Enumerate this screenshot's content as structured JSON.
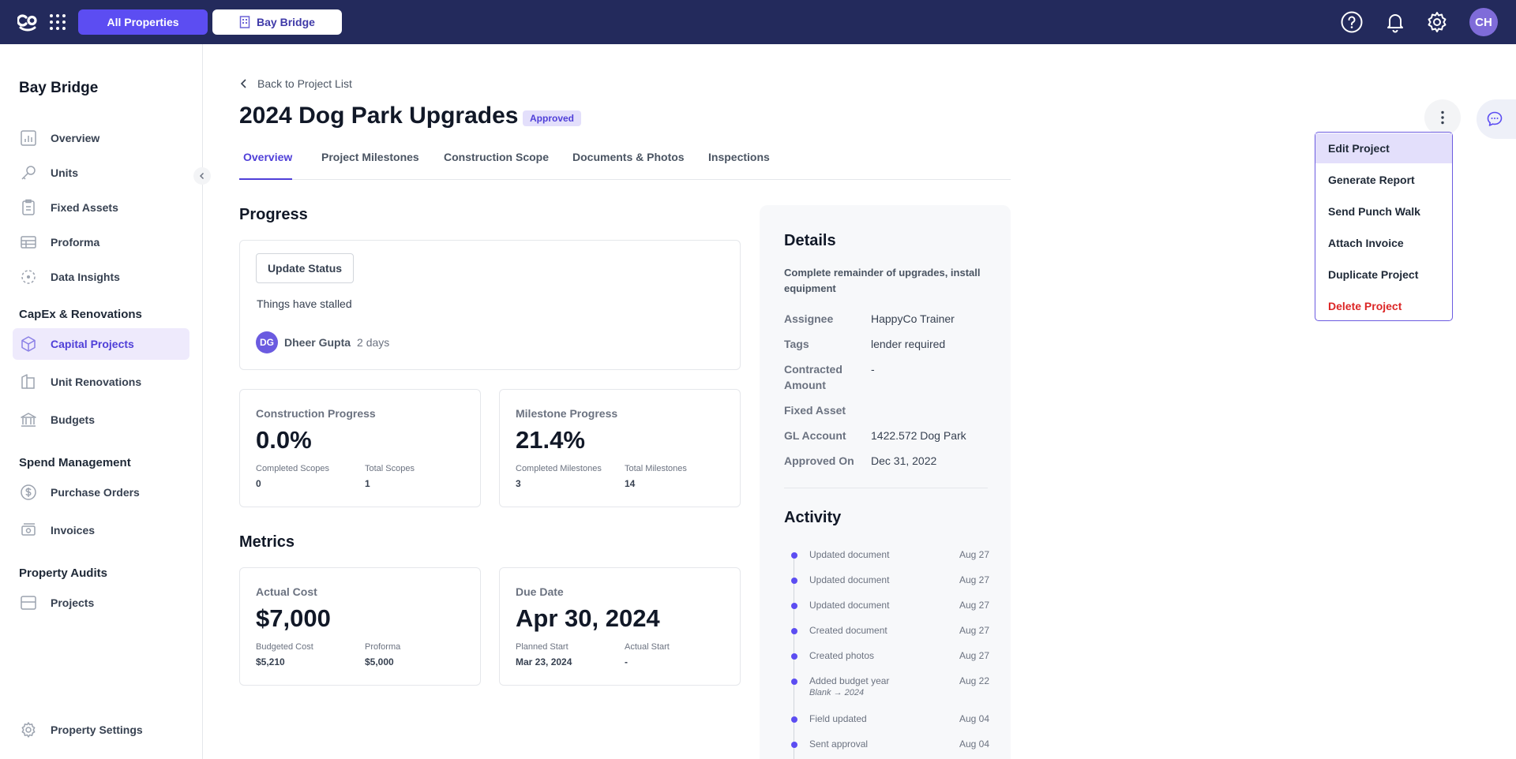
{
  "topbar": {
    "all_properties": "All Properties",
    "property": "Bay Bridge",
    "avatar_initials": "CH"
  },
  "sidebar": {
    "title": "Bay Bridge",
    "items": [
      {
        "label": "Overview",
        "icon": "chart-icon"
      },
      {
        "label": "Units",
        "icon": "key-icon"
      },
      {
        "label": "Fixed Assets",
        "icon": "clipboard-icon"
      },
      {
        "label": "Proforma",
        "icon": "table-icon"
      },
      {
        "label": "Data Insights",
        "icon": "insights-icon"
      }
    ],
    "section_capex": "CapEx & Renovations",
    "capex_items": [
      {
        "label": "Capital Projects",
        "icon": "box-icon",
        "active": true
      },
      {
        "label": "Unit Renovations",
        "icon": "paint-icon"
      },
      {
        "label": "Budgets",
        "icon": "bank-icon"
      }
    ],
    "section_spend": "Spend Management",
    "spend_items": [
      {
        "label": "Purchase Orders",
        "icon": "dollar-icon"
      },
      {
        "label": "Invoices",
        "icon": "invoice-icon"
      }
    ],
    "section_audits": "Property Audits",
    "audit_items": [
      {
        "label": "Projects",
        "icon": "projects-icon"
      }
    ],
    "settings_label": "Property Settings"
  },
  "page": {
    "back_label": "Back to Project List",
    "title": "2024 Dog Park Upgrades",
    "status_badge": "Approved",
    "tabs": [
      "Overview",
      "Project Milestones",
      "Construction Scope",
      "Documents & Photos",
      "Inspections"
    ],
    "active_tab": "Overview"
  },
  "progress": {
    "heading": "Progress",
    "update_button": "Update Status",
    "status_text": "Things have stalled",
    "user_initials": "DG",
    "user_name": "Dheer Gupta",
    "time_ago": "2 days"
  },
  "construction": {
    "label": "Construction Progress",
    "value": "0.0%",
    "completed_label": "Completed Scopes",
    "completed_value": "0",
    "total_label": "Total Scopes",
    "total_value": "1"
  },
  "milestones": {
    "label": "Milestone Progress",
    "value": "21.4%",
    "completed_label": "Completed Milestones",
    "completed_value": "3",
    "total_label": "Total Milestones",
    "total_value": "14"
  },
  "metrics": {
    "heading": "Metrics",
    "cost": {
      "label": "Actual Cost",
      "value": "$7,000",
      "budgeted_label": "Budgeted Cost",
      "budgeted_value": "$5,210",
      "proforma_label": "Proforma",
      "proforma_value": "$5,000"
    },
    "due": {
      "label": "Due Date",
      "value": "Apr 30, 2024",
      "planned_label": "Planned Start",
      "planned_value": "Mar 23, 2024",
      "actual_label": "Actual Start",
      "actual_value": "-"
    }
  },
  "details": {
    "heading": "Details",
    "description": "Complete remainder of upgrades, install equipment",
    "assignee_label": "Assignee",
    "assignee_value": "HappyCo Trainer",
    "tags_label": "Tags",
    "tags_value": "lender required",
    "contracted_label": "Contracted Amount",
    "contracted_value": "-",
    "fixed_asset_label": "Fixed Asset",
    "fixed_asset_value": "",
    "gl_label": "GL Account",
    "gl_value": "1422.572 Dog Park",
    "approved_label": "Approved On",
    "approved_value": "Dec 31, 2022"
  },
  "activity": {
    "heading": "Activity",
    "items": [
      {
        "text": "Updated document",
        "date": "Aug 27"
      },
      {
        "text": "Updated document",
        "date": "Aug 27"
      },
      {
        "text": "Updated document",
        "date": "Aug 27"
      },
      {
        "text": "Created document",
        "date": "Aug 27"
      },
      {
        "text": "Created photos",
        "date": "Aug 27"
      },
      {
        "text": "Added budget year",
        "sub": "Blank → 2024",
        "date": "Aug 22"
      },
      {
        "text": "Field updated",
        "date": "Aug 04"
      },
      {
        "text": "Sent approval",
        "date": "Aug 04"
      }
    ]
  },
  "menu": {
    "items": [
      "Edit Project",
      "Generate Report",
      "Send Punch Walk",
      "Attach Invoice",
      "Duplicate Project",
      "Delete Project"
    ]
  },
  "colors": {
    "topbar": "#232a5c",
    "accent": "#5c4df2",
    "danger": "#dc2626"
  }
}
